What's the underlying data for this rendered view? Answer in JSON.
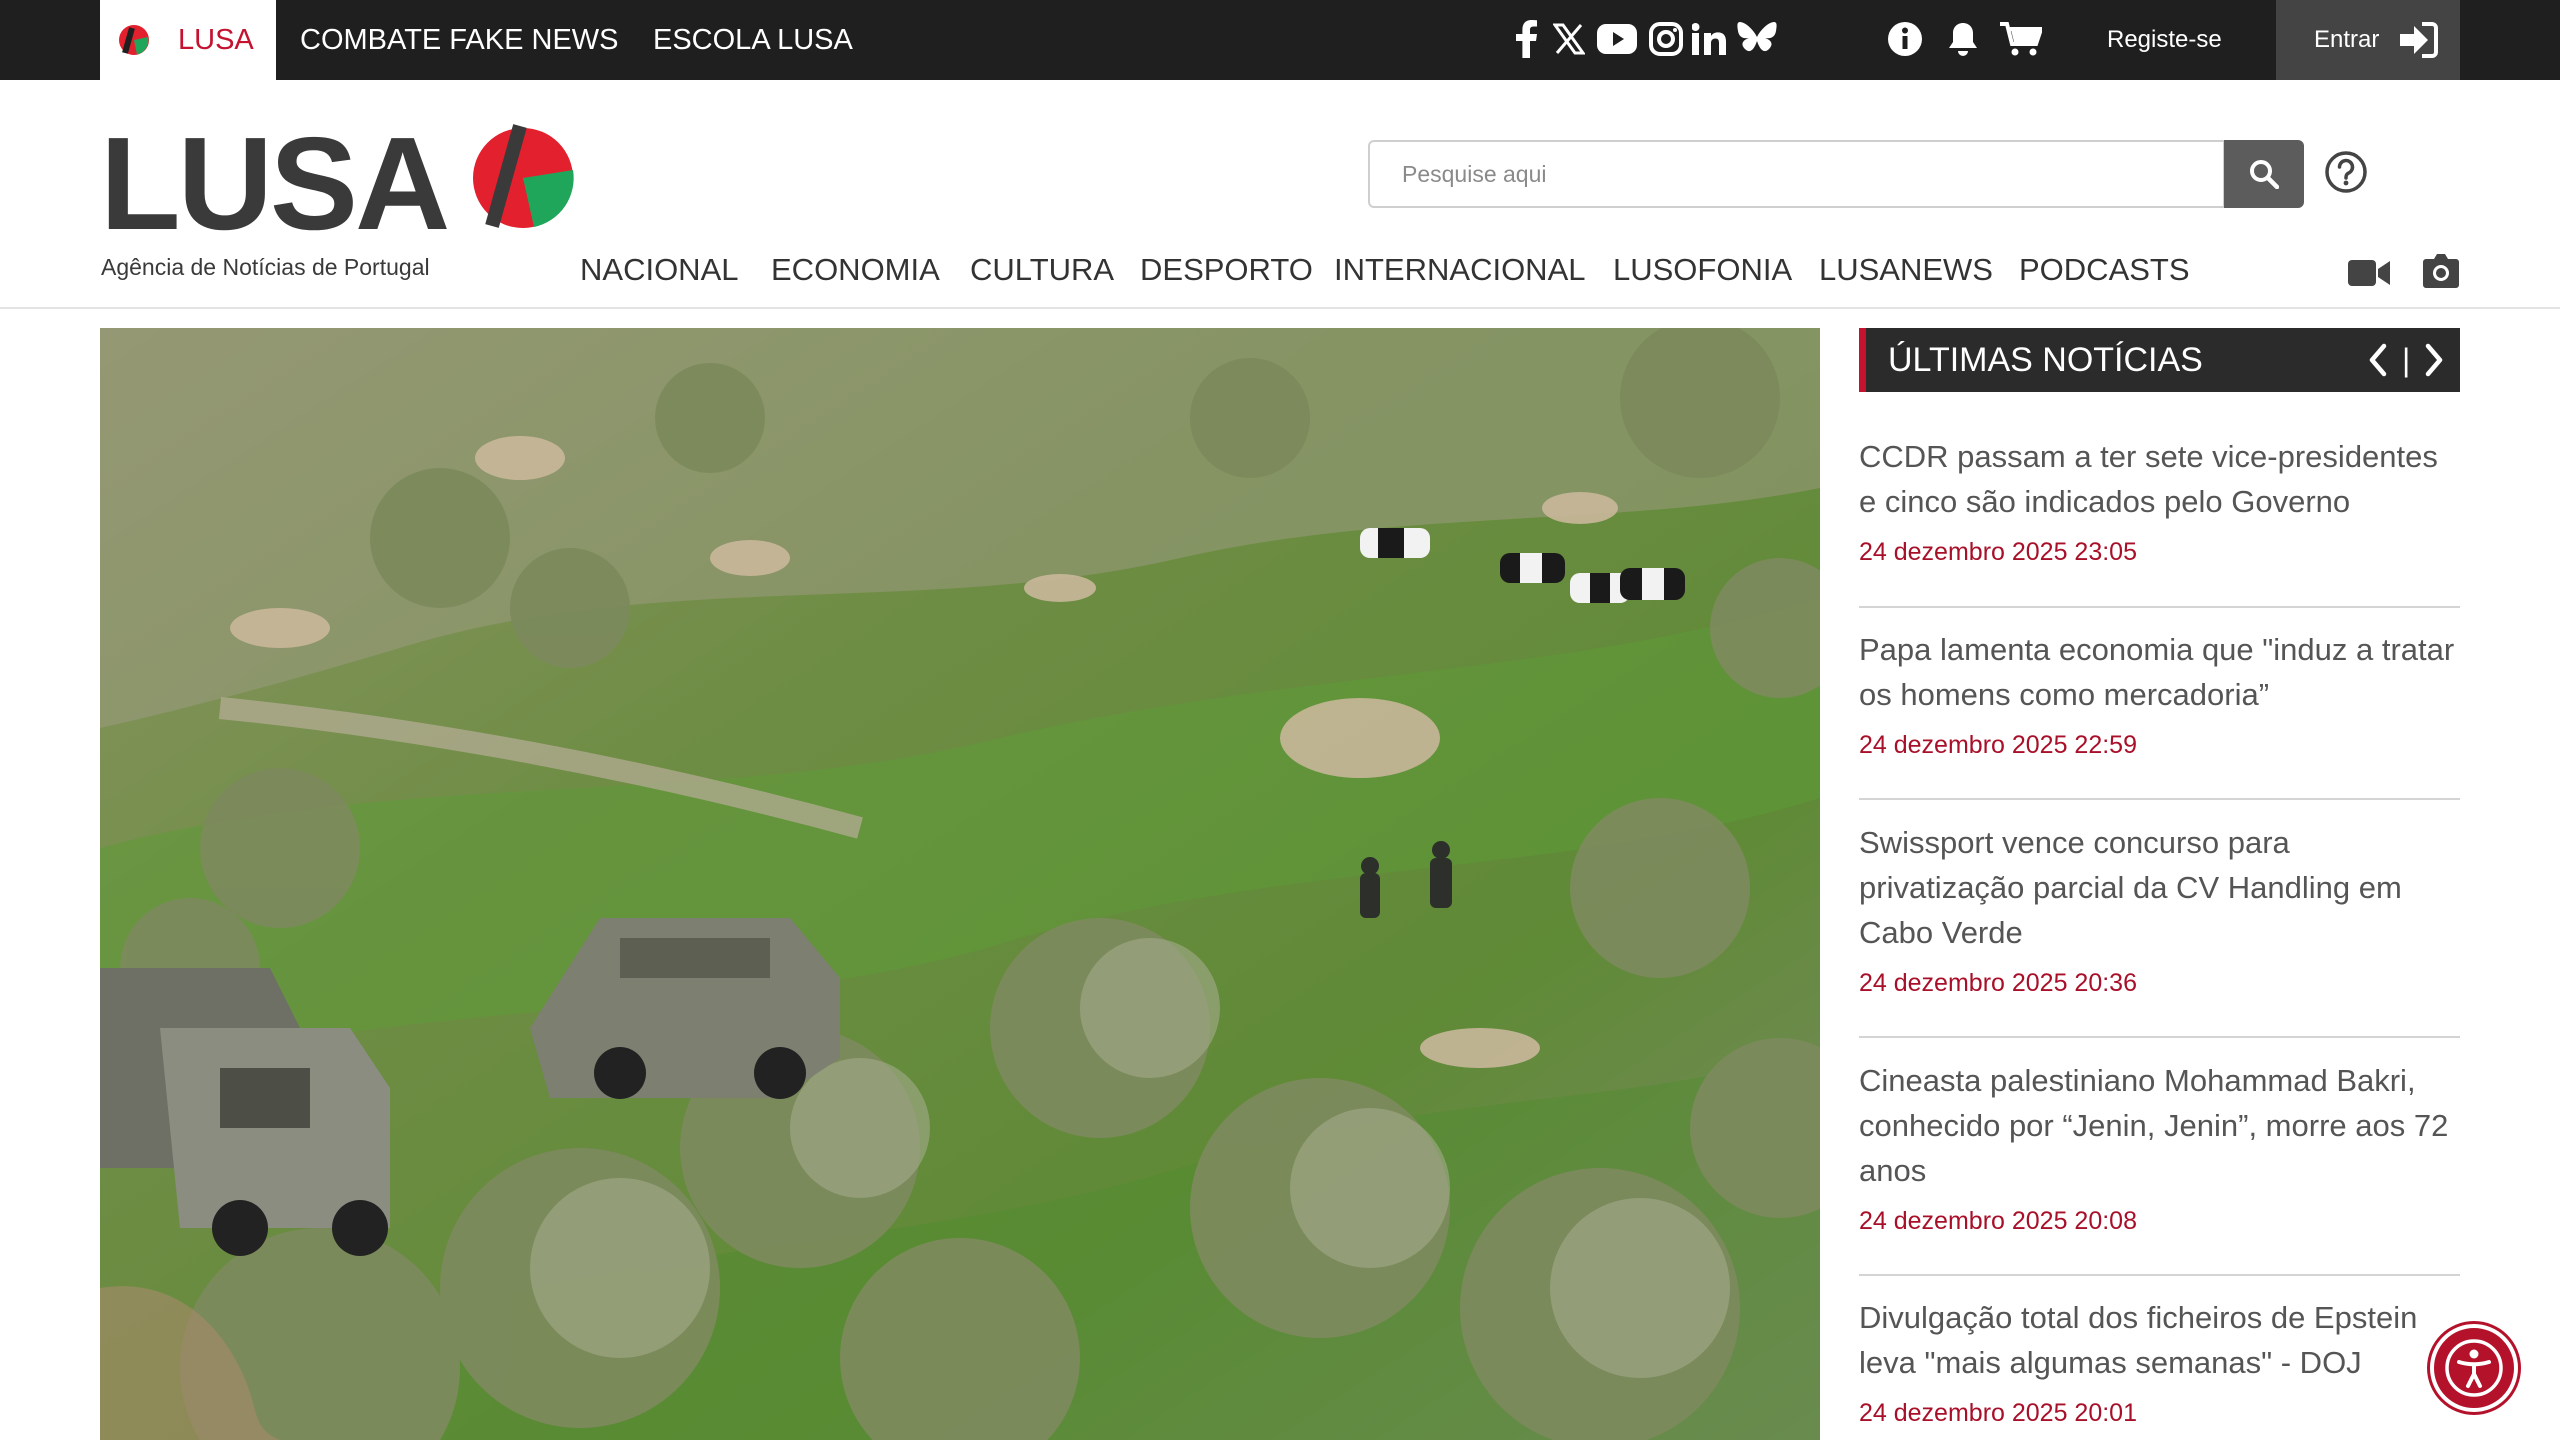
{
  "topbar": {
    "tabs": [
      {
        "label": "LUSA",
        "active": true
      },
      {
        "label": "COMBATE FAKE NEWS"
      },
      {
        "label": "ESCOLA LUSA"
      }
    ],
    "social_icons": [
      "facebook-icon",
      "x-icon",
      "youtube-icon",
      "instagram-icon",
      "linkedin-icon",
      "bluesky-icon"
    ],
    "utility_icons": [
      "info-icon",
      "bell-icon",
      "cart-icon"
    ],
    "register_label": "Registe-se",
    "login_label": "Entrar"
  },
  "brand": {
    "wordmark": "LUSA",
    "tagline": "Agência de Notícias de Portugal",
    "colors": {
      "red": "#e3202e",
      "green": "#1fa65a",
      "dark": "#3a3a3a"
    }
  },
  "search": {
    "placeholder": "Pesquise aqui"
  },
  "nav": {
    "items": [
      "NACIONAL",
      "ECONOMIA",
      "CULTURA",
      "DESPORTO",
      "INTERNACIONAL",
      "LUSOFONIA",
      "LUSANEWS",
      "PODCASTS"
    ],
    "media_icons": [
      "video-camera-icon",
      "photo-camera-icon"
    ]
  },
  "latest": {
    "title": "ÚLTIMAS NOTÍCIAS",
    "items": [
      {
        "headline": "CCDR passam a ter sete vice-presidentes e cinco são indicados pelo Governo",
        "date": "24 dezembro 2025 23:05"
      },
      {
        "headline": "Papa lamenta economia que \"induz a tratar os homens como mercadoria”",
        "date": "24 dezembro 2025 22:59"
      },
      {
        "headline": "Swissport vence concurso para privatização parcial da CV Handling em Cabo Verde",
        "date": "24 dezembro 2025 20:36"
      },
      {
        "headline": "Cineasta palestiniano Mohammad Bakri, conhecido por “Jenin, Jenin”, morre aos 72 anos",
        "date": "24 dezembro 2025 20:08"
      },
      {
        "headline": "Divulgação total dos ficheiros de Epstein leva \"mais algumas semanas\" - DOJ",
        "date": "24 dezembro 2025 20:01"
      }
    ]
  },
  "colors": {
    "accent": "#c4122f",
    "topbar": "#1f1f1f",
    "date": "#a8102a"
  }
}
